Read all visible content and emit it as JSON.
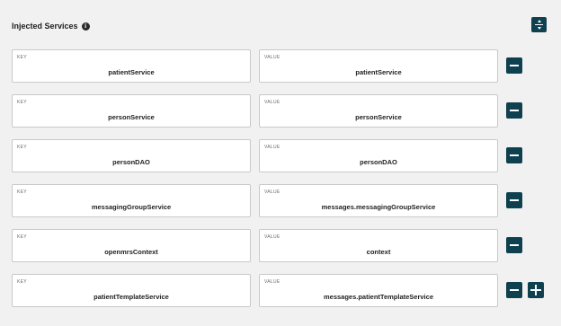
{
  "section": {
    "title": "Injected Services",
    "info_icon": "info-icon",
    "collapse_icon": "collapse-expand-icon"
  },
  "labels": {
    "key": "KEY",
    "value": "VALUE"
  },
  "rows": [
    {
      "key": "patientService",
      "value": "patientService"
    },
    {
      "key": "personService",
      "value": "personService"
    },
    {
      "key": "personDAO",
      "value": "personDAO"
    },
    {
      "key": "messagingGroupService",
      "value": "messages.messagingGroupService"
    },
    {
      "key": "openmrsContext",
      "value": "context"
    },
    {
      "key": "patientTemplateService",
      "value": "messages.patientTemplateService"
    }
  ],
  "colors": {
    "accent": "#0f4050",
    "background": "#f1f1f1",
    "field_border": "#c9c9c9"
  },
  "icons": {
    "remove": "minus-icon",
    "add": "plus-icon",
    "info": "info-icon"
  }
}
